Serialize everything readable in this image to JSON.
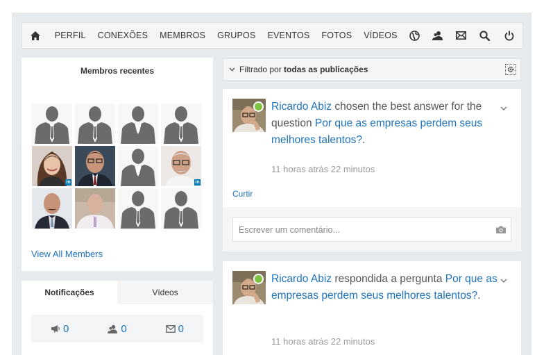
{
  "nav": {
    "items": [
      "PERFIL",
      "CONEXÕES",
      "MEMBROS",
      "GRUPOS",
      "EVENTOS",
      "FOTOS",
      "VÍDEOS"
    ],
    "icons": [
      "home-icon",
      "globe-icon",
      "friends-icon",
      "mail-icon",
      "search-icon",
      "power-icon"
    ]
  },
  "members": {
    "title": "Membros recentes",
    "view_all": "View All Members",
    "grid": [
      "placeholder",
      "placeholder",
      "placeholder",
      "placeholder",
      "woman-photo",
      "man-suit-photo",
      "placeholder",
      "man-glasses-photo",
      "man-tie-photo",
      "man-gray-photo",
      "placeholder",
      "placeholder"
    ]
  },
  "notifications": {
    "tabs": [
      "Notificações",
      "Vídeos"
    ],
    "counts": {
      "alerts": "0",
      "requests": "0",
      "messages": "0"
    }
  },
  "filter": {
    "prefix": "Filtrado por",
    "value": "todas as publicações"
  },
  "posts": [
    {
      "author": "Ricardo Abiz",
      "action": " chosen the best answer for the question ",
      "target": "Por que as empresas perdem seus melhores talentos?",
      "suffix": ".",
      "time": "11 horas atrás 22 minutos",
      "like": "Curtir",
      "comment_placeholder": "Escrever um comentário..."
    },
    {
      "author": "Ricardo Abiz",
      "action": " respondida a pergunta ",
      "target": "Por que as empresas perdem seus melhores talentos?",
      "suffix": ".",
      "time": "11 horas atrás 22 minutos"
    }
  ],
  "colors": {
    "link": "#1e73be",
    "online": "#7ec242",
    "background": "#e8ebed"
  }
}
